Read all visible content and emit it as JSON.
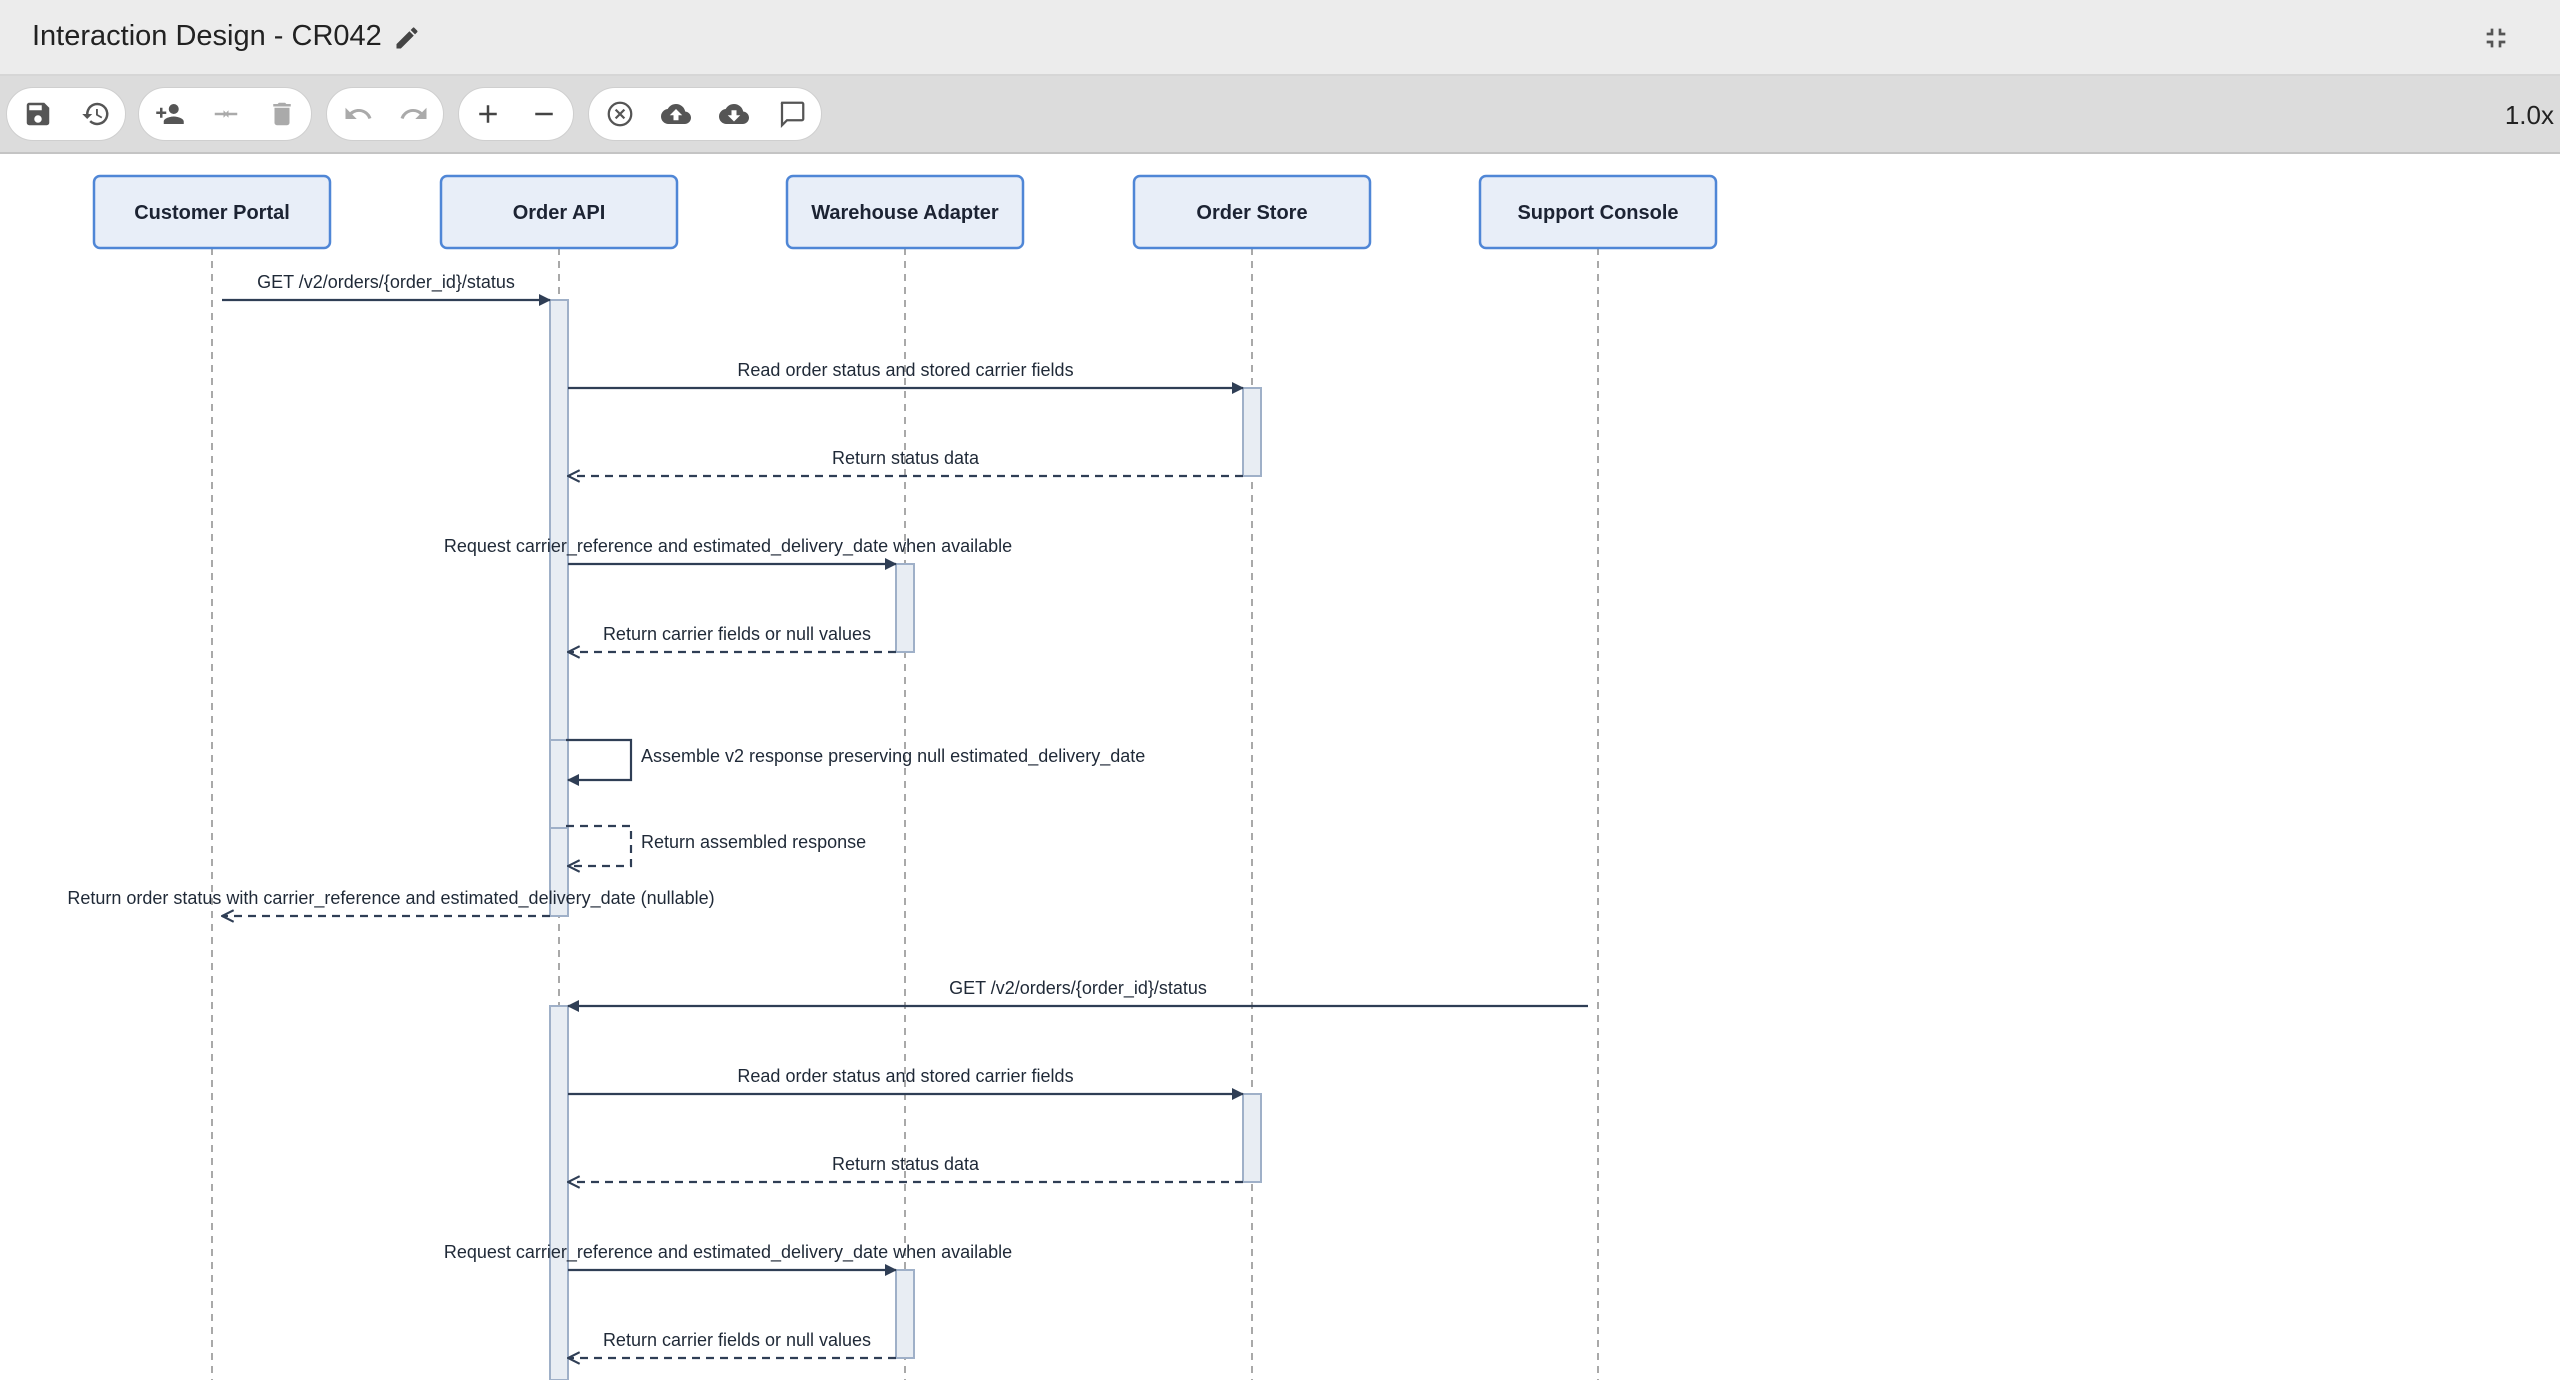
{
  "window": {
    "title": "Interaction Design - CR042",
    "zoom": "1.0x"
  },
  "toolbar": {
    "groups": [
      [
        "save-icon",
        "history-icon"
      ],
      [
        "add-participant-icon",
        "merge-icon",
        "delete-icon"
      ],
      [
        "undo-icon",
        "redo-icon"
      ],
      [
        "zoom-in-icon",
        "zoom-out-icon"
      ],
      [
        "cancel-icon",
        "upload-icon",
        "download-icon",
        "comment-icon"
      ]
    ]
  },
  "diagram": {
    "participants": [
      "Customer Portal",
      "Order API",
      "Warehouse Adapter",
      "Order Store",
      "Support Console"
    ],
    "messages": [
      {
        "from": "Customer Portal",
        "to": "Order API",
        "label": "GET /v2/orders/{order_id}/status",
        "style": "solid"
      },
      {
        "from": "Order API",
        "to": "Order Store",
        "label": "Read order status and stored carrier fields",
        "style": "solid"
      },
      {
        "from": "Order Store",
        "to": "Order API",
        "label": "Return status data",
        "style": "dashed"
      },
      {
        "from": "Order API",
        "to": "Warehouse Adapter",
        "label": "Request carrier_reference and estimated_delivery_date when available",
        "style": "solid"
      },
      {
        "from": "Warehouse Adapter",
        "to": "Order API",
        "label": "Return carrier fields or null values",
        "style": "dashed"
      },
      {
        "from": "Order API",
        "to": "Order API",
        "label": "Assemble v2 response preserving null estimated_delivery_date",
        "style": "solid"
      },
      {
        "from": "Order API",
        "to": "Order API",
        "label": "Return assembled response",
        "style": "dashed"
      },
      {
        "from": "Order API",
        "to": "Customer Portal",
        "label": "Return order status with carrier_reference and estimated_delivery_date (nullable)",
        "style": "dashed"
      },
      {
        "from": "Support Console",
        "to": "Order API",
        "label": "GET /v2/orders/{order_id}/status",
        "style": "solid"
      },
      {
        "from": "Order API",
        "to": "Order Store",
        "label": "Read order status and stored carrier fields",
        "style": "solid"
      },
      {
        "from": "Order Store",
        "to": "Order API",
        "label": "Return status data",
        "style": "dashed"
      },
      {
        "from": "Order API",
        "to": "Warehouse Adapter",
        "label": "Request carrier_reference and estimated_delivery_date when available",
        "style": "solid"
      },
      {
        "from": "Warehouse Adapter",
        "to": "Order API",
        "label": "Return carrier fields or null values",
        "style": "dashed"
      }
    ]
  }
}
